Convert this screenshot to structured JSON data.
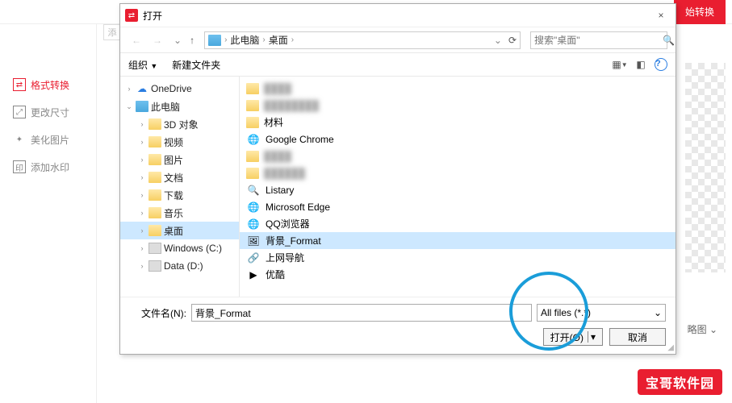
{
  "app": {
    "header_btn": "始转换",
    "sidebar": [
      {
        "label": "格式转换",
        "active": true
      },
      {
        "label": "更改尺寸",
        "active": false
      },
      {
        "label": "美化图片",
        "active": false
      },
      {
        "label": "添加水印",
        "active": false
      }
    ],
    "add_label": "添",
    "dropdown_label": "略图"
  },
  "dialog": {
    "title": "打开",
    "close": "×",
    "nav": {
      "crumb1": "此电脑",
      "crumb2": "桌面",
      "caret": "›",
      "search_placeholder": "搜索\"桌面\""
    },
    "toolbar": {
      "organize": "组织",
      "newfolder": "新建文件夹"
    },
    "tree": [
      {
        "exp": "›",
        "ico": "cloud",
        "label": "OneDrive",
        "depth": 0
      },
      {
        "exp": "⌄",
        "ico": "pc",
        "label": "此电脑",
        "depth": 0
      },
      {
        "exp": "›",
        "ico": "folder",
        "label": "3D 对象",
        "depth": 1
      },
      {
        "exp": "›",
        "ico": "folder",
        "label": "视频",
        "depth": 1
      },
      {
        "exp": "›",
        "ico": "folder",
        "label": "图片",
        "depth": 1
      },
      {
        "exp": "›",
        "ico": "folder",
        "label": "文档",
        "depth": 1
      },
      {
        "exp": "›",
        "ico": "folder",
        "label": "下载",
        "depth": 1
      },
      {
        "exp": "›",
        "ico": "folder",
        "label": "音乐",
        "depth": 1
      },
      {
        "exp": "›",
        "ico": "folder",
        "label": "桌面",
        "depth": 1,
        "sel": true
      },
      {
        "exp": "›",
        "ico": "drive",
        "label": "Windows (C:)",
        "depth": 1
      },
      {
        "exp": "›",
        "ico": "drive",
        "label": "Data (D:)",
        "depth": 1
      }
    ],
    "files": [
      {
        "ico": "folder",
        "label": "████",
        "blur": true
      },
      {
        "ico": "folder",
        "label": "████████",
        "blur": true
      },
      {
        "ico": "folder",
        "label": "材料"
      },
      {
        "ico": "chrome",
        "label": "Google Chrome"
      },
      {
        "ico": "folder",
        "label": "████",
        "blur": true
      },
      {
        "ico": "folder",
        "label": "██████",
        "blur": true
      },
      {
        "ico": "app",
        "label": "Listary"
      },
      {
        "ico": "edge",
        "label": "Microsoft Edge"
      },
      {
        "ico": "qq",
        "label": "QQ浏览器"
      },
      {
        "ico": "img",
        "label": "背景_Format",
        "sel": true
      },
      {
        "ico": "link",
        "label": "上网导航"
      },
      {
        "ico": "youku",
        "label": "优酷"
      }
    ],
    "footer": {
      "filename_label": "文件名(N):",
      "filename_value": "背景_Format",
      "filetype": "All files (*.*)",
      "open": "打开(O)",
      "cancel": "取消"
    }
  },
  "watermark": "宝哥软件园"
}
